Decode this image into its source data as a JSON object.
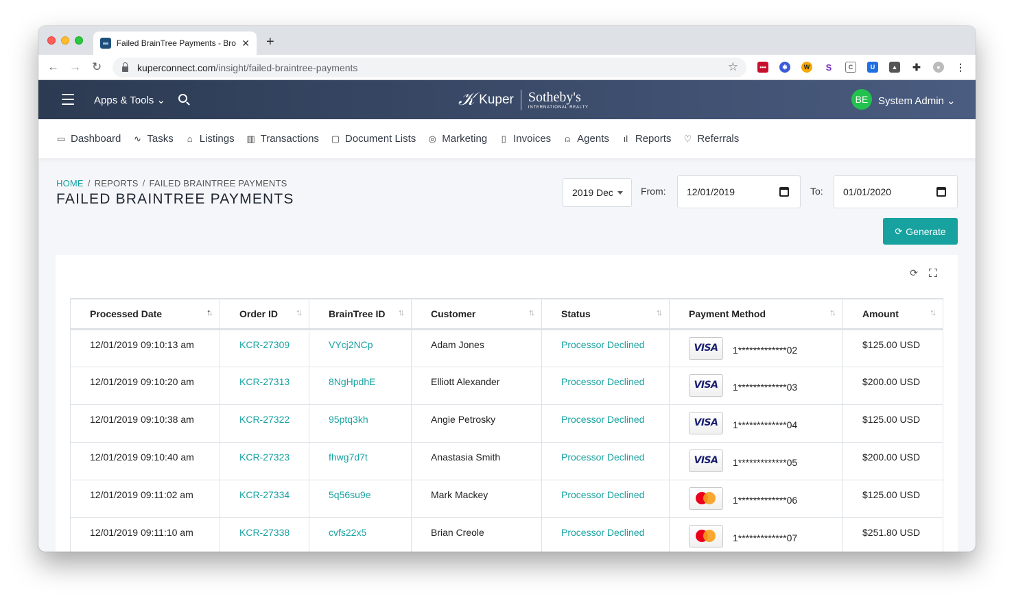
{
  "browser": {
    "tab_title": "Failed BrainTree Payments - Bro",
    "url_host": "kuperconnect.com",
    "url_path": "/insight/failed-braintree-payments"
  },
  "header": {
    "apps_tools": "Apps & Tools",
    "logo_left": "Kuper",
    "logo_right": "Sotheby's",
    "logo_sub": "INTERNATIONAL REALTY",
    "avatar_initials": "BE",
    "user_name": "System Admin"
  },
  "nav": {
    "items": [
      {
        "label": "Dashboard",
        "icon": "monitor-icon"
      },
      {
        "label": "Tasks",
        "icon": "pulse-icon"
      },
      {
        "label": "Listings",
        "icon": "home-icon"
      },
      {
        "label": "Transactions",
        "icon": "building-icon"
      },
      {
        "label": "Document Lists",
        "icon": "folder-icon"
      },
      {
        "label": "Marketing",
        "icon": "aperture-icon"
      },
      {
        "label": "Invoices",
        "icon": "file-icon"
      },
      {
        "label": "Agents",
        "icon": "user-icon"
      },
      {
        "label": "Reports",
        "icon": "bar-chart-icon"
      },
      {
        "label": "Referrals",
        "icon": "heart-icon"
      }
    ]
  },
  "page": {
    "breadcrumb": {
      "home": "HOME",
      "reports": "REPORTS",
      "current": "FAILED BRAINTREE PAYMENTS"
    },
    "title": "FAILED BRAINTREE PAYMENTS",
    "period": "2019 Dec",
    "from_label": "From:",
    "from_value": "12/01/2019",
    "to_label": "To:",
    "to_value": "01/01/2020",
    "generate_label": "Generate"
  },
  "table": {
    "columns": [
      "Processed Date",
      "Order ID",
      "BrainTree ID",
      "Customer",
      "Status",
      "Payment Method",
      "Amount"
    ],
    "rows": [
      {
        "date": "12/01/2019 09:10:13 am",
        "order": "KCR-27309",
        "bt": "VYcj2NCp",
        "customer": "Adam Jones",
        "status": "Processor Declined",
        "card": "visa",
        "masked": "1*************02",
        "amount": "$125.00 USD"
      },
      {
        "date": "12/01/2019 09:10:20 am",
        "order": "KCR-27313",
        "bt": "8NgHpdhE",
        "customer": "Elliott Alexander",
        "status": "Processor Declined",
        "card": "visa",
        "masked": "1*************03",
        "amount": "$200.00 USD"
      },
      {
        "date": "12/01/2019 09:10:38 am",
        "order": "KCR-27322",
        "bt": "95ptq3kh",
        "customer": "Angie Petrosky",
        "status": "Processor Declined",
        "card": "visa",
        "masked": "1*************04",
        "amount": "$125.00 USD"
      },
      {
        "date": "12/01/2019 09:10:40 am",
        "order": "KCR-27323",
        "bt": "fhwg7d7t",
        "customer": "Anastasia Smith",
        "status": "Processor Declined",
        "card": "visa",
        "masked": "1*************05",
        "amount": "$200.00 USD"
      },
      {
        "date": "12/01/2019 09:11:02 am",
        "order": "KCR-27334",
        "bt": "5q56su9e",
        "customer": "Mark Mackey",
        "status": "Processor Declined",
        "card": "mastercard",
        "masked": "1*************06",
        "amount": "$125.00 USD"
      },
      {
        "date": "12/01/2019 09:11:10 am",
        "order": "KCR-27338",
        "bt": "cvfs22x5",
        "customer": "Brian Creole",
        "status": "Processor Declined",
        "card": "mastercard",
        "masked": "1*************07",
        "amount": "$251.80 USD"
      }
    ]
  },
  "colors": {
    "accent": "#17a2a0",
    "header": "#2c3a52",
    "avatar": "#23c14d"
  }
}
